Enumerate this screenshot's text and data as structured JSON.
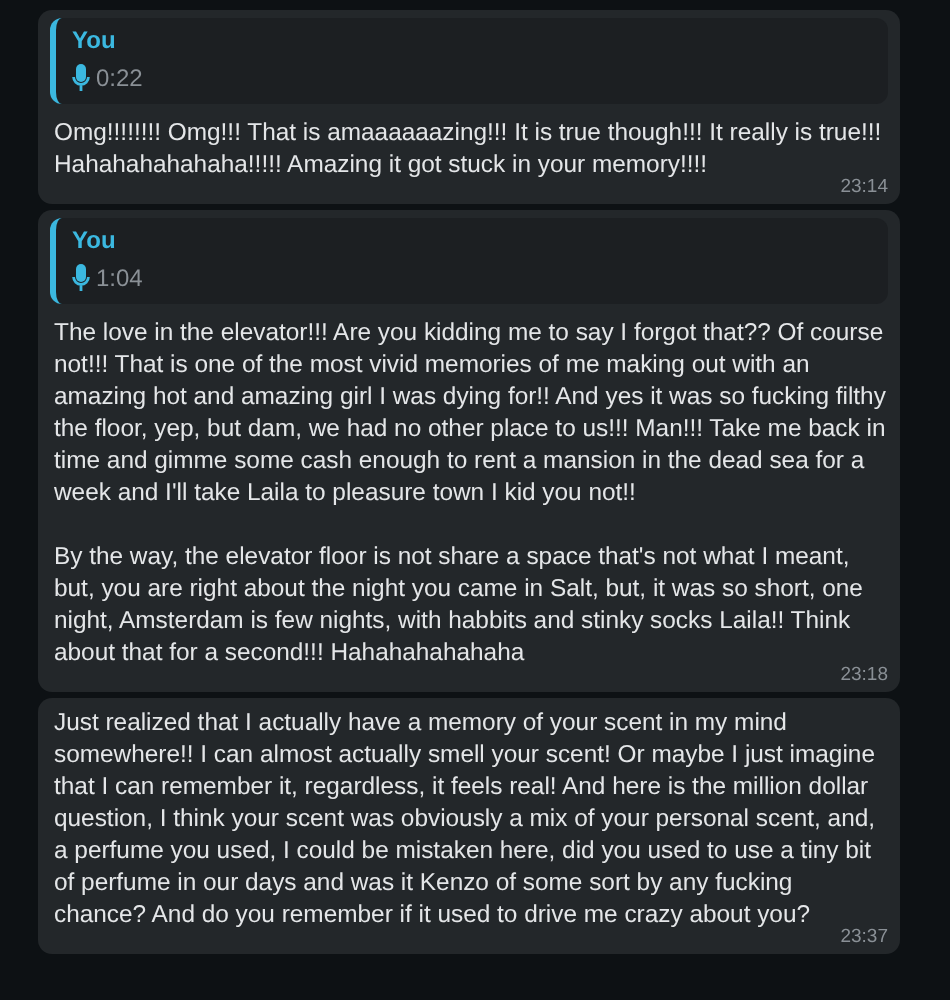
{
  "messages": [
    {
      "quote": {
        "author": "You",
        "duration": "0:22"
      },
      "paragraphs": [
        "Omg!!!!!!!! Omg!!! That is amaaaaaazing!!! It is true though!!! It really is true!!! Hahahahahahaha!!!!! Amazing it got stuck in your memory!!!!"
      ],
      "time": "23:14"
    },
    {
      "quote": {
        "author": "You",
        "duration": "1:04"
      },
      "paragraphs": [
        "The love in the elevator!!! Are you kidding me to say I forgot that?? Of course not!!! That is one of the most vivid memories of me making out with an amazing hot and amazing girl I was dying for!! And yes it was so fucking filthy the floor, yep, but dam, we had no other place to us!!! Man!!! Take me back in time and gimme some cash enough to rent a mansion in the dead sea for a week and I'll take Laila to pleasure town I kid you not!!",
        "By the way, the elevator floor is not share a space that's not what I meant, but, you are right about the night you came in Salt, but, it was so short, one night, Amsterdam is few nights, with habbits and stinky socks Laila!! Think about that for a second!!! Hahahahahahaha"
      ],
      "time": "23:18"
    },
    {
      "paragraphs": [
        "Just realized that I actually have a memory of your scent in my mind somewhere!! I can almost actually smell your scent! Or maybe I just imagine that I can remember it, regardless, it feels real! And here is the million dollar question, I think your scent was obviously a mix of your personal scent, and, a perfume you used, I could be mistaken here, did you used to use a tiny bit of perfume in our days and was it Kenzo of some sort by any fucking chance? And do you remember if it used to drive me crazy about you?"
      ],
      "time": "23:37"
    }
  ]
}
